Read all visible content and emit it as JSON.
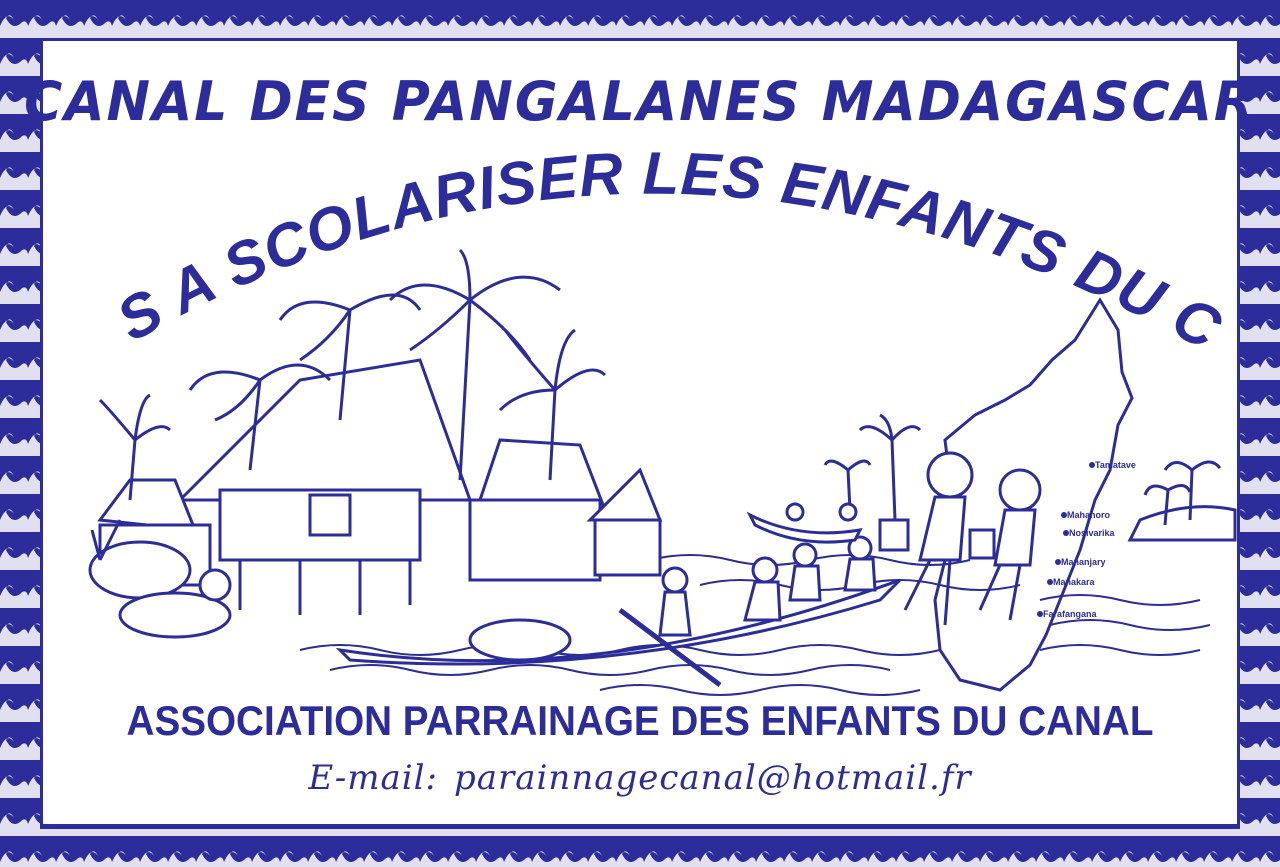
{
  "poster": {
    "title_line1": "CANAL DES PANGALANES MADAGASCAR",
    "title_line2": "AIDONS A SCOLARISER LES ENFANTS DU CANAL",
    "association": "ASSOCIATION PARRAINAGE DES ENFANTS DU CANAL",
    "email_label": "E-mail:",
    "email_value": "parainnagecanal@hotmail.fr",
    "map_towns": [
      "Tamatave",
      "Mahanoro",
      "Nosivarika",
      "Mananjary",
      "Manakara",
      "Farafangana"
    ]
  },
  "colors": {
    "primary": "#2c2c9a",
    "background": "#ffffff"
  }
}
